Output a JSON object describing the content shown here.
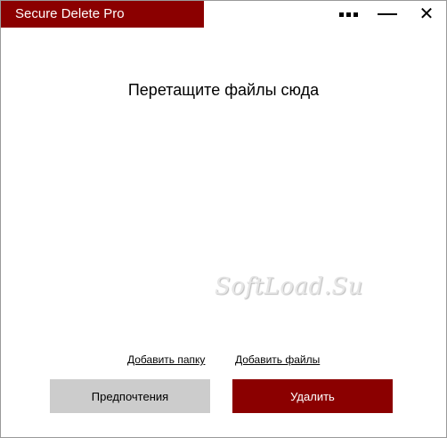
{
  "window": {
    "title": "Secure Delete Pro"
  },
  "drop_zone": {
    "text": "Перетащите файлы сюда"
  },
  "watermark": {
    "text": "SoftLoad.Su"
  },
  "links": {
    "add_folder": "Добавить папку",
    "add_files": "Добавить файлы"
  },
  "buttons": {
    "preferences": "Предпочтения",
    "delete": "Удалить"
  },
  "icons": {
    "menu": "dots-menu-icon",
    "minimize": "minimize-icon",
    "close": "close-icon",
    "close_glyph": "✕"
  },
  "colors": {
    "accent": "#8b0000",
    "secondary_button": "#cccccc"
  }
}
